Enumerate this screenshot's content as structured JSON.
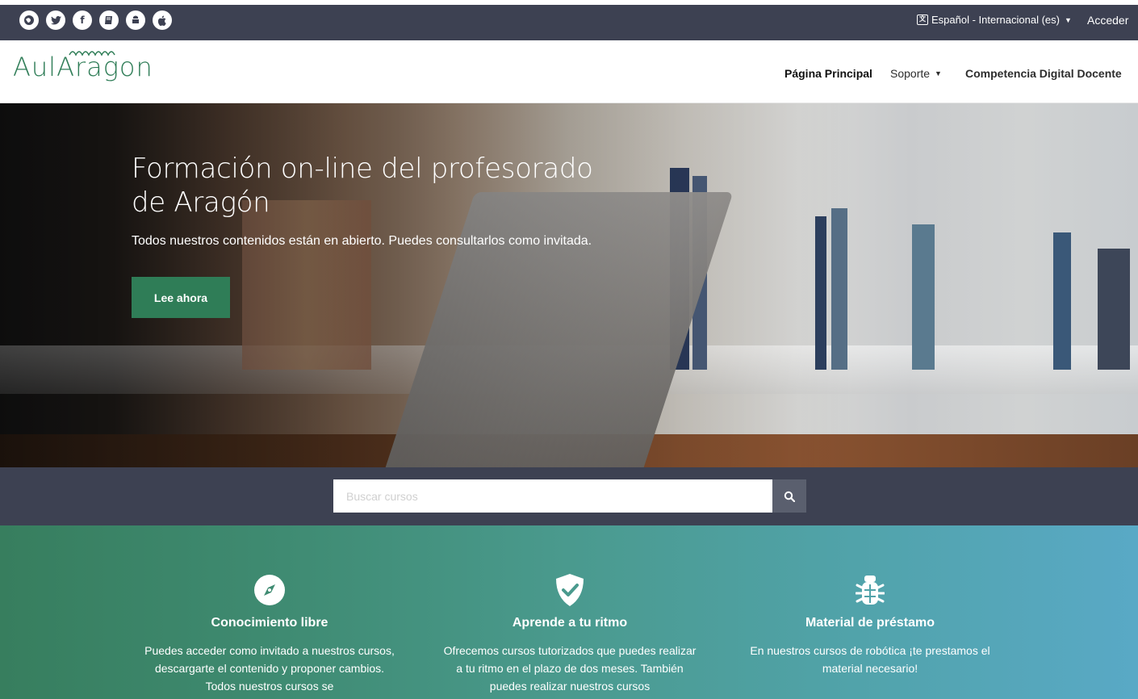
{
  "topbar": {
    "social_icons": [
      "globe-icon",
      "twitter-icon",
      "facebook-icon",
      "book-icon",
      "android-icon",
      "apple-icon"
    ],
    "social_glyphs": [
      "●",
      "t",
      "f",
      "▤",
      "◆",
      ""
    ],
    "language": "Español - Internacional (es)",
    "login": "Acceder"
  },
  "header": {
    "logo": "AulAragon",
    "nav": {
      "home": "Página Principal",
      "support": "Soporte",
      "competence": "Competencia Digital Docente"
    }
  },
  "hero": {
    "title": "Formación on-line del profesorado de Aragón",
    "subtitle": "Todos nuestros contenidos están en abierto. Puedes consultarlos como invitada.",
    "button": "Lee ahora"
  },
  "search": {
    "placeholder": "Buscar cursos",
    "value": ""
  },
  "features": [
    {
      "icon": "compass-icon",
      "title": "Conocimiento libre",
      "text": "Puedes acceder como invitado a nuestros cursos, descargarte el contenido y proponer cambios. Todos nuestros cursos se"
    },
    {
      "icon": "shield-check-icon",
      "title": "Aprende a tu ritmo",
      "text": "Ofrecemos cursos tutorizados que puedes realizar a tu ritmo en el plazo de dos meses. También puedes realizar nuestros cursos"
    },
    {
      "icon": "bug-icon",
      "title": "Material de préstamo",
      "text": "En nuestros cursos de robótica ¡te prestamos el material necesario!"
    }
  ],
  "colors": {
    "brand_green": "#2f7d57",
    "dark_bar": "#3d4152"
  }
}
